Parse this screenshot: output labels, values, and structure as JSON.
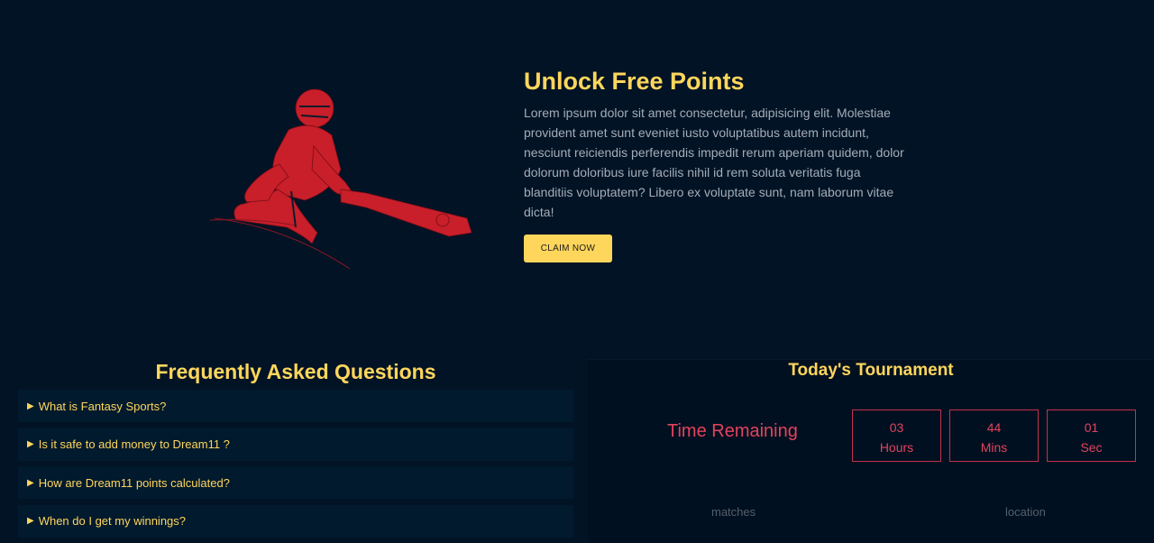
{
  "hero": {
    "title": "Unlock Free Points",
    "body": "Lorem ipsum dolor sit amet consectetur, adipisicing elit. Molestiae provident amet sunt eveniet iusto voluptatibus autem incidunt, nesciunt reiciendis perferendis impedit rerum aperiam quidem, dolor dolorum doloribus iure facilis nihil id rem soluta veritatis fuga blanditiis voluptatem? Libero ex voluptate sunt, nam laborum vitae dicta!",
    "cta_label": "CLAIM NOW"
  },
  "faq": {
    "title": "Frequently Asked Questions",
    "marker": "▶",
    "items": [
      "What is Fantasy Sports?",
      "Is it safe to add money to Dream11 ?",
      "How are Dream11 points calculated?",
      "When do I get my winnings?"
    ]
  },
  "tournament": {
    "title": "Today's Tournament",
    "time_label": "Time Remaining",
    "countdown": [
      {
        "value": "03",
        "unit": "Hours"
      },
      {
        "value": "44",
        "unit": "Mins"
      },
      {
        "value": "01",
        "unit": "Sec"
      }
    ],
    "stats": [
      "matches",
      "location"
    ]
  },
  "colors": {
    "background": "#011325",
    "accent_yellow": "#ffd65c",
    "accent_red": "#e2435e",
    "art_red": "#c81f2a"
  },
  "icons": {
    "hero_art": "cricket-batsman-illustration",
    "faq_marker": "triangle-right-icon"
  }
}
